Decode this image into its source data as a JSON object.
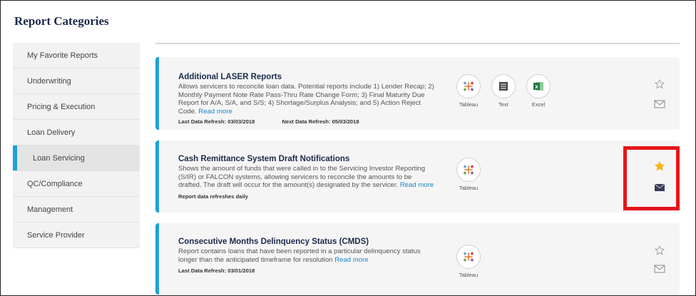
{
  "page": {
    "title": "Report Categories"
  },
  "sidebar": {
    "items": [
      {
        "label": "My Favorite Reports"
      },
      {
        "label": "Underwriting"
      },
      {
        "label": "Pricing & Execution"
      },
      {
        "label": "Loan Delivery"
      },
      {
        "label": "Loan Servicing",
        "active": true
      },
      {
        "label": "QC/Compliance"
      },
      {
        "label": "Management"
      },
      {
        "label": "Service Provider"
      }
    ]
  },
  "reports": [
    {
      "title": "Additional LASER Reports",
      "description": "Allows servicers to reconcile loan data. Potential reports include 1) Lender Recap; 2) Monthly Payment Note Rate Pass-Thru Rate Change Form; 3) Final Maturity Due Report for A/A, S/A, and S/S; 4) Shortage/Surplus Analysis; and 5) Action Reject Code.",
      "read_more": "Read more",
      "last_refresh_label": "Last Data Refresh:",
      "last_refresh": "03/03/2018",
      "next_refresh_label": "Next Data Refresh:",
      "next_refresh": "05/03/2018",
      "formats": [
        "Tableau",
        "Text",
        "Excel"
      ],
      "favorite": false
    },
    {
      "title": "Cash Remittance System Draft Notifications",
      "description": "Shows the amount of funds that were called in to the Servicing Investor Reporting (S/IR) or FALCON systems, allowing servicers to reconcile the amounts to be drafted. The draft will occur for the amount(s) designated by the servicer.",
      "read_more": "Read more",
      "refresh_note": "Report data refreshes daily",
      "formats": [
        "Tableau"
      ],
      "favorite": true
    },
    {
      "title": "Consecutive Months Delinquency Status (CMDS)",
      "description": "Report contains loans that have been reported in a particular delinquency status longer than the anticipated timeframe for resolution",
      "read_more": "Read more",
      "last_refresh_label": "Last Data Refresh:",
      "last_refresh": "03/01/2018",
      "formats": [
        "Tableau"
      ],
      "favorite": false
    }
  ],
  "icons": {
    "star": "star-icon",
    "mail": "envelope-icon",
    "tableau": "tableau-icon",
    "text": "text-file-icon",
    "excel": "excel-icon"
  },
  "colors": {
    "accent": "#1da1d8",
    "title": "#1b2a4a",
    "link": "#1a87c9",
    "favorite_star": "#f5b301",
    "highlight": "#e3151a",
    "active_mail": "#3b3a5a"
  }
}
